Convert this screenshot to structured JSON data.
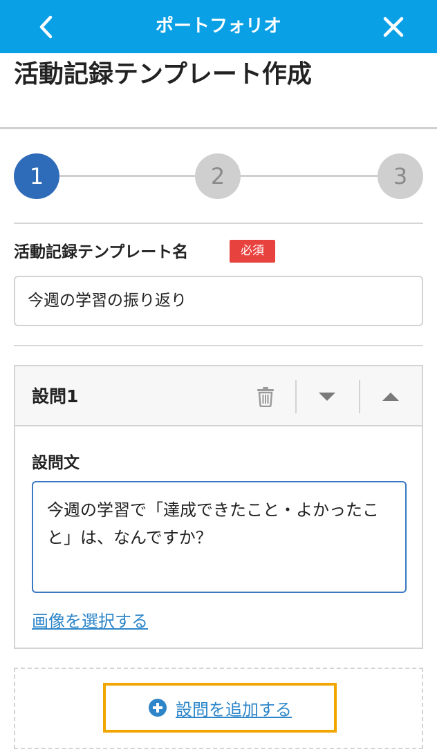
{
  "header": {
    "title": "ポートフォリオ",
    "back_icon": "chevron-left-icon",
    "close_icon": "close-icon",
    "background": "#0aa0e6"
  },
  "page_title": "活動記録テンプレート作成",
  "stepper": {
    "steps": [
      "1",
      "2",
      "3"
    ],
    "current": 1
  },
  "template_name": {
    "label": "活動記録テンプレート名",
    "required_badge": "必須",
    "value": "今週の学習の振り返り"
  },
  "question": {
    "title": "設問1",
    "text_label": "設問文",
    "text_value": "今週の学習で「達成できたこと・よかったこと」は、なんですか？",
    "select_image_link": "画像を選択する",
    "icons": [
      "trash-icon",
      "caret-down-icon",
      "caret-up-icon"
    ]
  },
  "add_question": {
    "label": "設問を追加する",
    "icon": "plus-circle-icon"
  }
}
